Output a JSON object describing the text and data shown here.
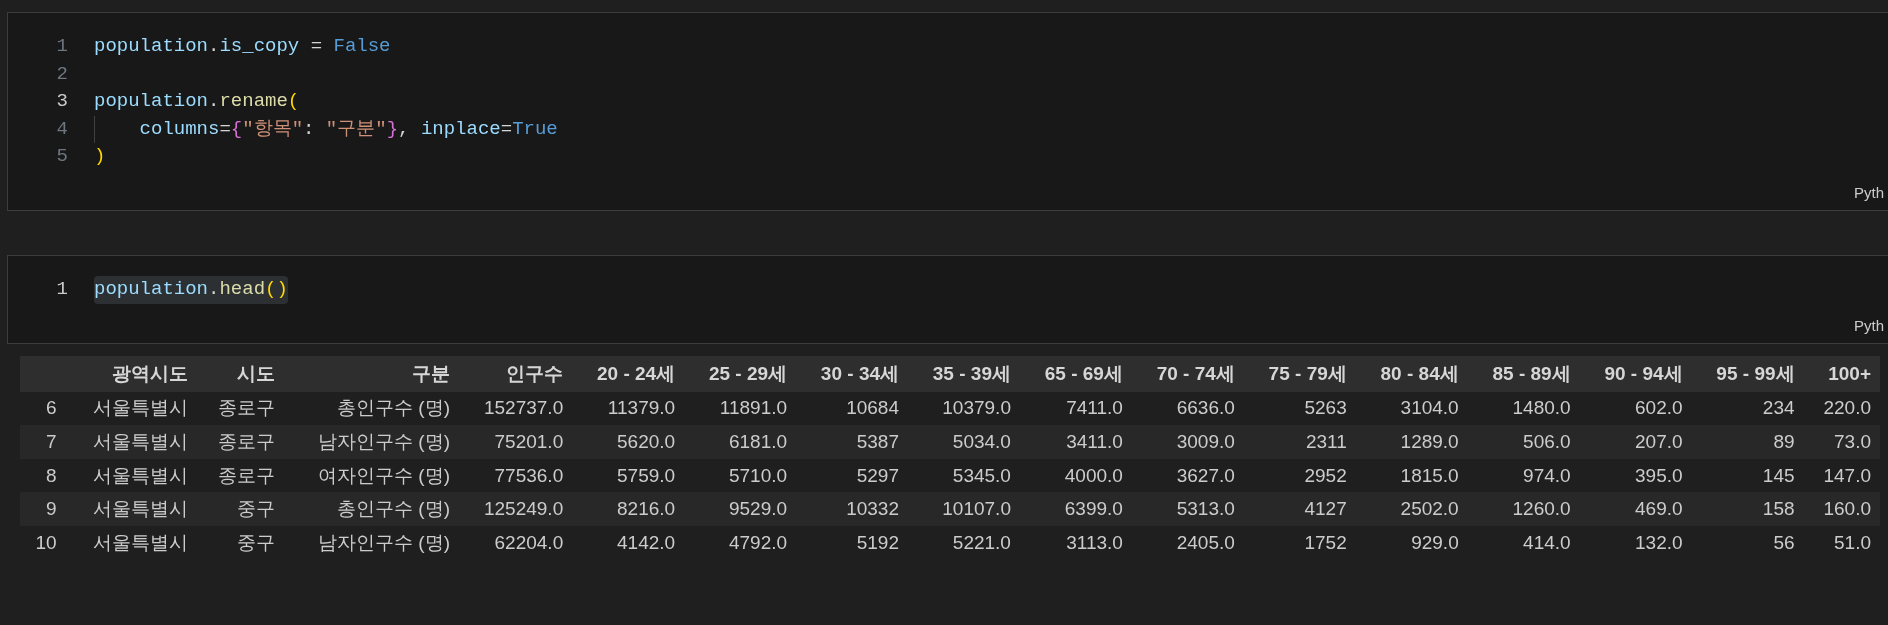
{
  "cells": [
    {
      "lines": [
        {
          "number": "1",
          "active": false,
          "indented": false,
          "highlighted": false,
          "tokens": [
            {
              "text": "population",
              "kind": "variable"
            },
            {
              "text": ".",
              "kind": "operator"
            },
            {
              "text": "is_copy",
              "kind": "variable"
            },
            {
              "text": " = ",
              "kind": "operator"
            },
            {
              "text": "False",
              "kind": "keyword"
            }
          ]
        },
        {
          "number": "2",
          "active": false,
          "indented": false
        },
        {
          "number": "3",
          "active": true,
          "indented": false,
          "highlighted": false,
          "tokens": [
            {
              "text": "population",
              "kind": "variable"
            },
            {
              "text": ".",
              "kind": "operator"
            },
            {
              "text": "rename",
              "kind": "function"
            },
            {
              "text": "(",
              "kind": "bracket1"
            }
          ]
        },
        {
          "number": "4",
          "active": false,
          "indented": true,
          "highlighted": false,
          "tokens": [
            {
              "text": "columns",
              "kind": "variable"
            },
            {
              "text": "=",
              "kind": "operator"
            },
            {
              "text": "{",
              "kind": "bracket2"
            },
            {
              "text": "\"항목\"",
              "kind": "string"
            },
            {
              "text": ": ",
              "kind": "operator"
            },
            {
              "text": "\"구분\"",
              "kind": "string"
            },
            {
              "text": "}",
              "kind": "bracket2"
            },
            {
              "text": ", ",
              "kind": "operator"
            },
            {
              "text": "inplace",
              "kind": "variable"
            },
            {
              "text": "=",
              "kind": "operator"
            },
            {
              "text": "True",
              "kind": "keyword"
            }
          ]
        },
        {
          "number": "5",
          "active": false,
          "indented": false,
          "highlighted": false,
          "tokens": [
            {
              "text": ")",
              "kind": "bracket1"
            }
          ]
        }
      ],
      "language": "Pyth"
    },
    {
      "lines": [
        {
          "number": "1",
          "active": true,
          "indented": false,
          "highlighted": true,
          "tokens": [
            {
              "text": "population",
              "kind": "variable"
            },
            {
              "text": ".",
              "kind": "operator"
            },
            {
              "text": "head",
              "kind": "function"
            },
            {
              "text": "()",
              "kind": "bracket1"
            }
          ]
        }
      ],
      "language": "Pyth"
    }
  ],
  "output_table": {
    "columns": [
      "광역시도",
      "시도",
      "구분",
      "인구수",
      "20 - 24세",
      "25 - 29세",
      "30 - 34세",
      "35 - 39세",
      "65 - 69세",
      "70 - 74세",
      "75 - 79세",
      "80 - 84세",
      "85 - 89세",
      "90 - 94세",
      "95 - 99세",
      "100+"
    ],
    "rows": [
      {
        "index": "6",
        "cells": [
          "서울특별시",
          "종로구",
          "총인구수 (명)",
          "152737.0",
          "11379.0",
          "11891.0",
          "10684",
          "10379.0",
          "7411.0",
          "6636.0",
          "5263",
          "3104.0",
          "1480.0",
          "602.0",
          "234",
          "220.0"
        ]
      },
      {
        "index": "7",
        "cells": [
          "서울특별시",
          "종로구",
          "남자인구수 (명)",
          "75201.0",
          "5620.0",
          "6181.0",
          "5387",
          "5034.0",
          "3411.0",
          "3009.0",
          "2311",
          "1289.0",
          "506.0",
          "207.0",
          "89",
          "73.0"
        ]
      },
      {
        "index": "8",
        "cells": [
          "서울특별시",
          "종로구",
          "여자인구수 (명)",
          "77536.0",
          "5759.0",
          "5710.0",
          "5297",
          "5345.0",
          "4000.0",
          "3627.0",
          "2952",
          "1815.0",
          "974.0",
          "395.0",
          "145",
          "147.0"
        ]
      },
      {
        "index": "9",
        "cells": [
          "서울특별시",
          "중구",
          "총인구수 (명)",
          "125249.0",
          "8216.0",
          "9529.0",
          "10332",
          "10107.0",
          "6399.0",
          "5313.0",
          "4127",
          "2502.0",
          "1260.0",
          "469.0",
          "158",
          "160.0"
        ]
      },
      {
        "index": "10",
        "cells": [
          "서울특별시",
          "중구",
          "남자인구수 (명)",
          "62204.0",
          "4142.0",
          "4792.0",
          "5192",
          "5221.0",
          "3113.0",
          "2405.0",
          "1752",
          "929.0",
          "414.0",
          "132.0",
          "56",
          "51.0"
        ]
      }
    ]
  }
}
